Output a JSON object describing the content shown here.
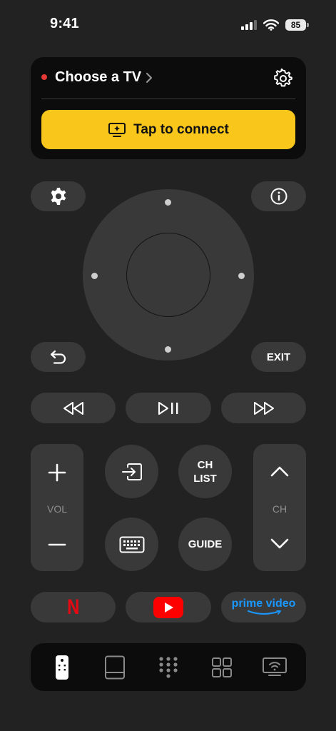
{
  "status_bar": {
    "time": "9:41",
    "battery": "85"
  },
  "tv_panel": {
    "title": "Choose a TV",
    "connect_label": "Tap to connect"
  },
  "remote": {
    "exit_label": "EXIT",
    "vol_label": "VOL",
    "ch_label": "CH",
    "ch_list_line1": "CH",
    "ch_list_line2": "LIST",
    "guide_label": "GUIDE"
  },
  "apps": {
    "netflix": "N",
    "prime_line1": "prime video"
  },
  "tabs": [
    "remote",
    "touchpad",
    "numpad",
    "apps",
    "screen-mirror"
  ],
  "colors": {
    "accent": "#f9c71b",
    "status_dot": "#e53935",
    "netflix": "#e50914",
    "youtube": "#ff0000",
    "prime": "#1a98ff"
  }
}
